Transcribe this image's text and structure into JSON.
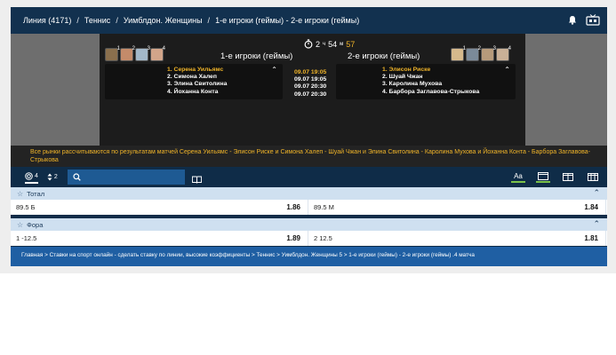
{
  "header": {
    "crumbs": [
      "Линия (4171)",
      "Теннис",
      "Уимблдон. Женщины",
      "1-е игроки (геймы) - 2-е игроки (геймы)"
    ],
    "separator": "/",
    "icons": [
      "bell-icon",
      "tv-icon"
    ]
  },
  "timer": {
    "hours": "2",
    "separator_1": "ч",
    "value": "54",
    "separator_2": "м",
    "minutes": "57"
  },
  "team1": {
    "title": "1-е игроки (геймы)",
    "players": [
      "1. Серена Уильямс",
      "2. Симона Халеп",
      "3. Элина Свитолина",
      "4. Йоханна Конта"
    ],
    "avatar_numbers": [
      "1",
      "2",
      "3",
      "4"
    ]
  },
  "team2": {
    "title": "2-е игроки (геймы)",
    "players": [
      "1. Элисон Риске",
      "2. Шуай Чжан",
      "3. Каролина Мухова",
      "4. Барбора Заглавова-Стрыкова"
    ],
    "avatar_numbers": [
      "1",
      "2",
      "3",
      "4"
    ]
  },
  "dates": [
    "09.07 19:05",
    "09.07 19:05",
    "09.07 20:30",
    "09.07 20:30"
  ],
  "notice": "Все рынки рассчитываются по результатам матчей Серена Уильямс - Элисон Риске и Симона Халеп - Шуай Чжан и Элина Свитолина - Каролина Мухова и Йоханна Конта - Барбора Заглавова-Стрыкова",
  "toolbar": {
    "count_1": "4",
    "count_2": "2",
    "search_placeholder": "",
    "view_icons": [
      "font-size-icon",
      "single-column-icon",
      "two-column-icon",
      "three-column-icon"
    ]
  },
  "markets": [
    {
      "title": "Тотал",
      "outcomes": [
        {
          "label": "89.5 Б",
          "odd": "1.86"
        },
        {
          "label": "89.5 М",
          "odd": "1.84"
        }
      ]
    },
    {
      "title": "Фора",
      "outcomes": [
        {
          "label": "1 -12.5",
          "odd": "1.89"
        },
        {
          "label": "2 12.5",
          "odd": "1.81"
        }
      ]
    }
  ],
  "footer": "Главная > Ставки на спорт онлайн - сделать ставку по линии, высокие коэффициенты > Теннис > Уимблдон. Женщины 5 > 1-е игроки (геймы) - 2-е игроки (геймы) .4 матча",
  "colors": {
    "accent": "#f0b429",
    "header": "#12314f",
    "search": "#1e5a93",
    "footer": "#1f5fa3",
    "market_head": "#cfe0f0"
  }
}
